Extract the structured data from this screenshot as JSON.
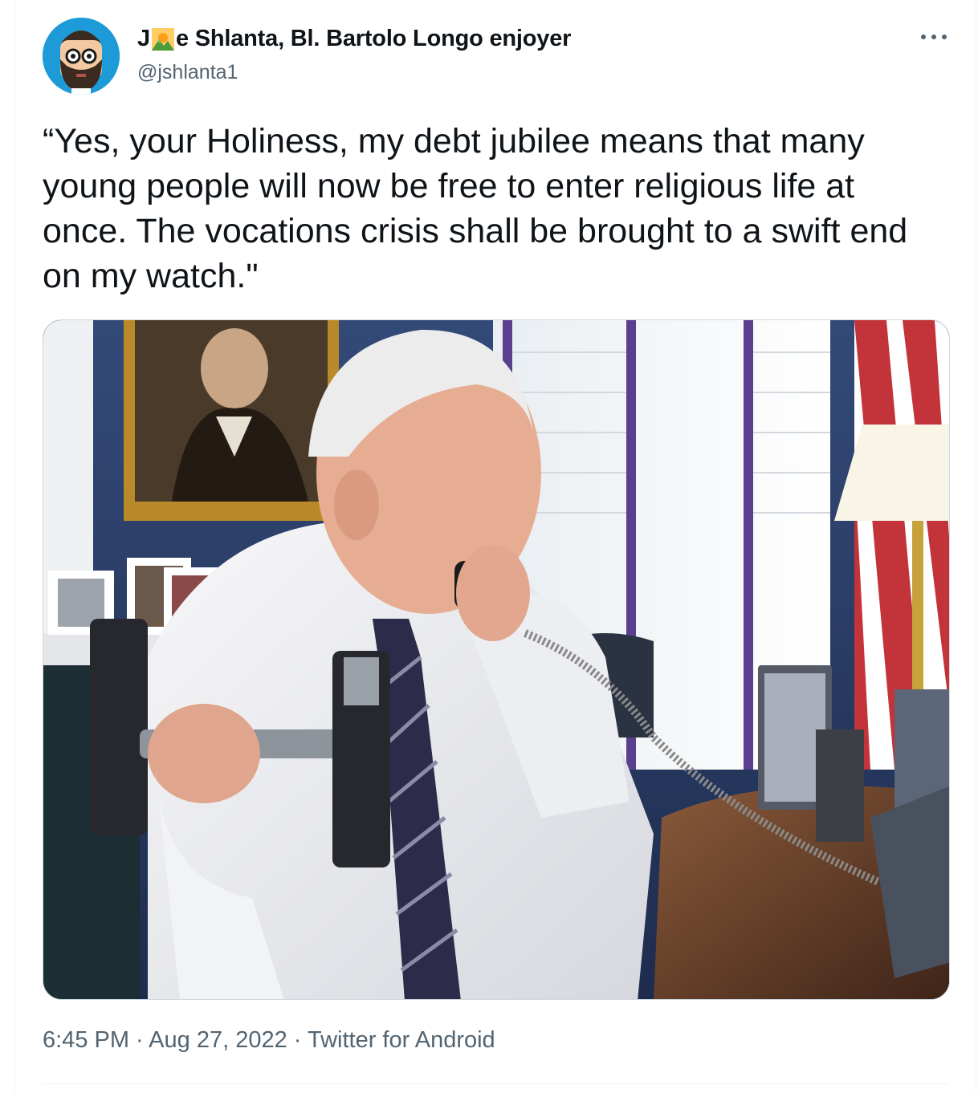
{
  "author": {
    "name_prefix": "J",
    "name_suffix": "e Shlanta, Bl. Bartolo Longo enjoyer",
    "handle": "@jshlanta1",
    "name_emoji": "sunrise-over-mountains-emoji"
  },
  "tweet": {
    "text": "“Yes, your Holiness, my debt jubilee means that many young people will now be free to enter religious life at once. The vocations crisis shall be brought to a swift end on my watch.\""
  },
  "meta": {
    "time": "6:45 PM",
    "separator": " · ",
    "date": "Aug 27, 2022",
    "source": "Twitter for Android"
  },
  "icons": {
    "more": "more-horizontal-icon",
    "avatar": "cartoon-avatar-bearded-man"
  },
  "colors": {
    "text_primary": "#0f1419",
    "text_secondary": "#536471",
    "avatar_bg": "#1d9bd8",
    "border": "#cfd9de"
  }
}
